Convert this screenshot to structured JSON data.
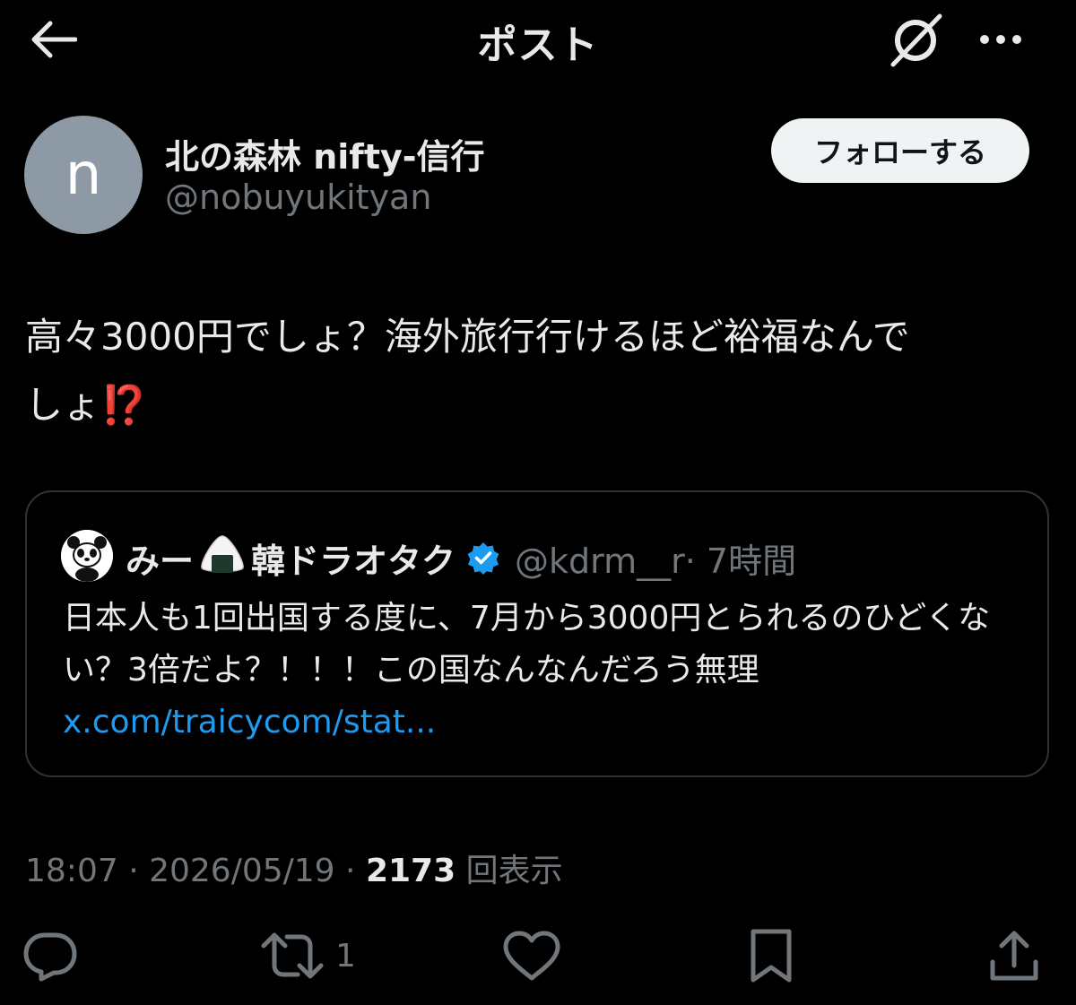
{
  "header": {
    "title": "ポスト"
  },
  "author": {
    "avatar_letter": "n",
    "avatar_color": "#8d9aa6",
    "name": "北の森林 nifty-信行",
    "handle": "@nobuyukityan",
    "follow_label": "フォローする"
  },
  "post": {
    "text_line1": "高々3000円でしょ？海外旅行行けるほど裕福なんで",
    "text_line2": "しょ",
    "emoji": "⁉️"
  },
  "quote": {
    "name_prefix": "みー",
    "name_suffix": "韓ドラオタク",
    "handle": "@kdrm__r",
    "time": "· 7時間",
    "text": "日本人も1回出国する度に、7月から3000円とられるのひどくない？3倍だよ？！！！この国なんなんだろう無理 ",
    "link": "x.com/traicycom/stat..."
  },
  "meta": {
    "time": "18:07",
    "separator": " · ",
    "date": "2026/05/19",
    "separator2": " · ",
    "views_count": "2173",
    "views_label": " 回表示"
  },
  "actions": {
    "retweet_count": "1"
  },
  "colors": {
    "background": "#000000",
    "text": "#e7e9ea",
    "secondary": "#71767b",
    "link": "#1d9bf0",
    "border": "#2f3336",
    "follow_bg": "#eff3f4"
  }
}
